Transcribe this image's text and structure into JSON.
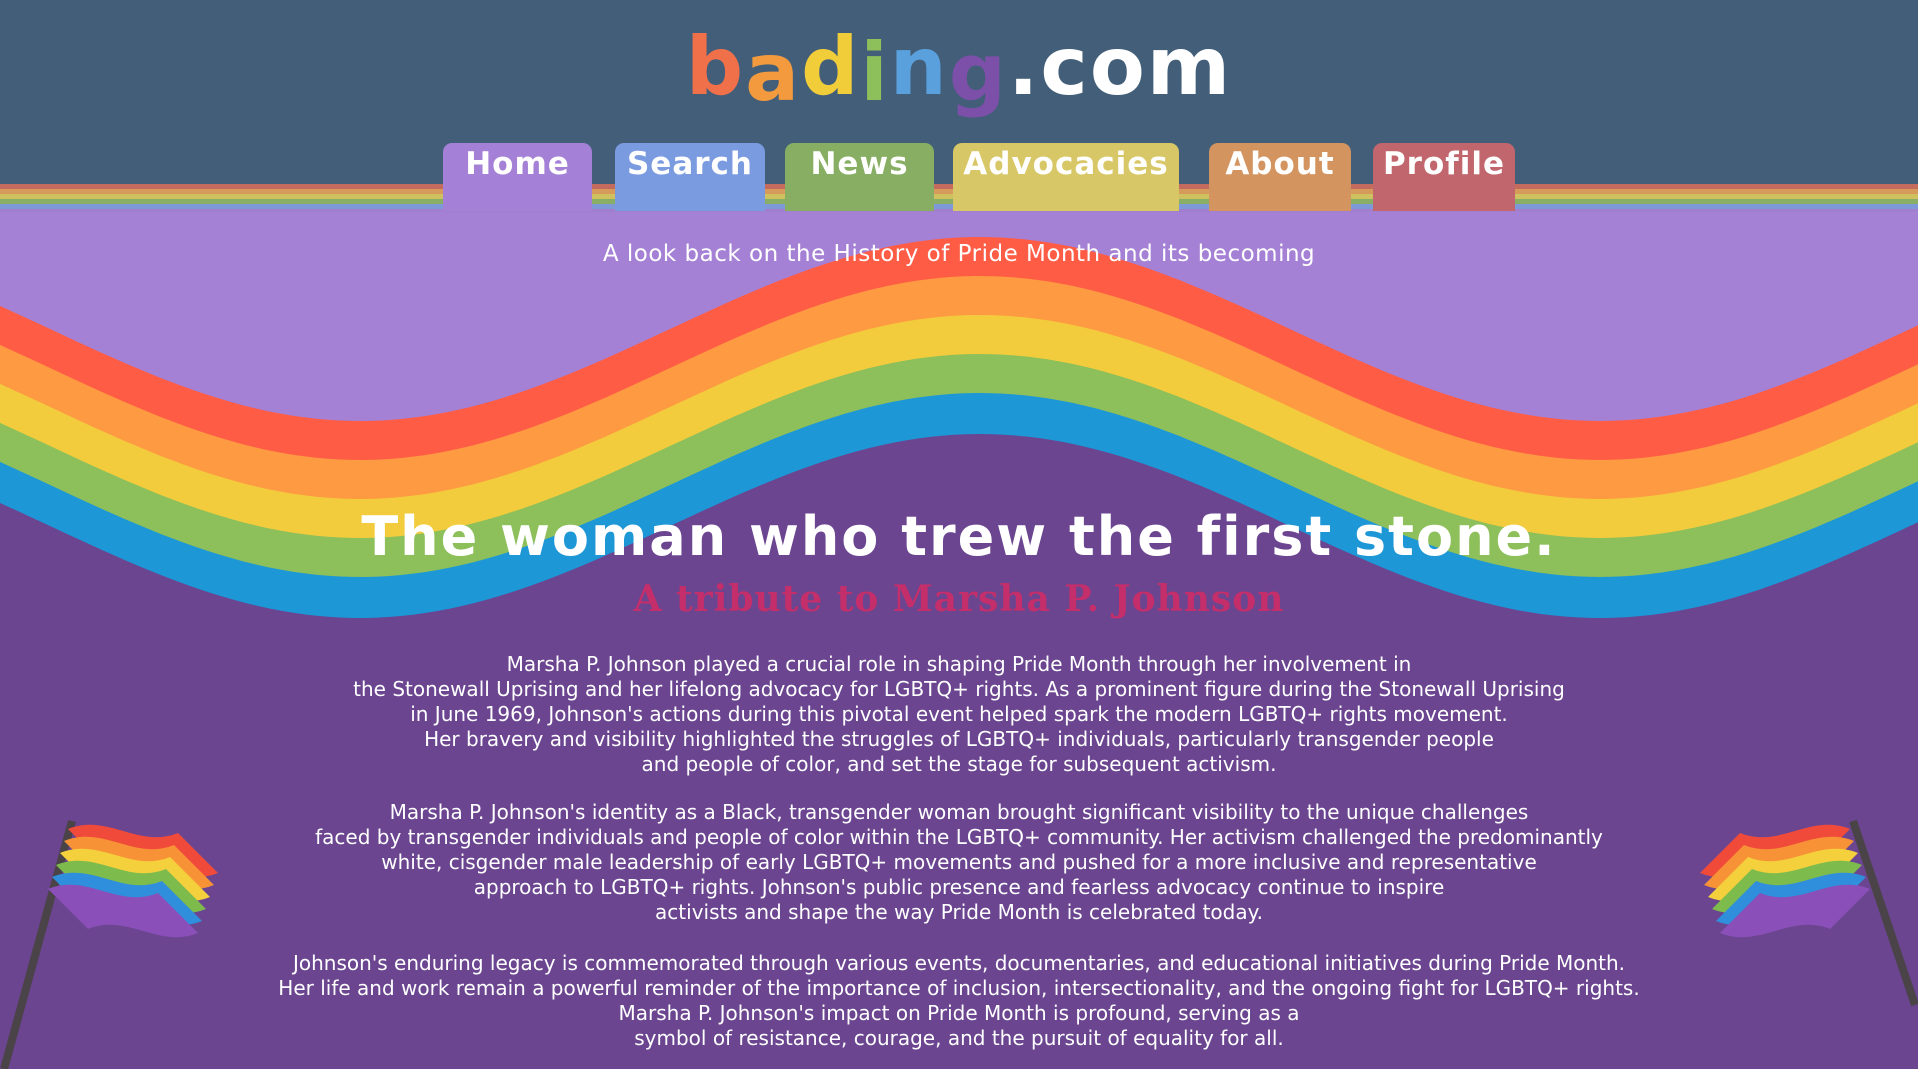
{
  "site": {
    "logo": {
      "letters": [
        {
          "char": "b",
          "color": "#f0704a"
        },
        {
          "char": "a",
          "color": "#f39a3e"
        },
        {
          "char": "d",
          "color": "#f2cd3a"
        },
        {
          "char": "i",
          "color": "#8dbf5b"
        },
        {
          "char": "n",
          "color": "#5aa0dc"
        },
        {
          "char": "g",
          "color": "#7c4fa8"
        },
        {
          "char": ".com",
          "color": "#ffffff"
        }
      ]
    }
  },
  "nav": {
    "tabs": [
      {
        "label": "Home",
        "color": "#a481d6",
        "active": true
      },
      {
        "label": "Search",
        "color": "#7b9be0",
        "active": false
      },
      {
        "label": "News",
        "color": "#87ae62",
        "active": false
      },
      {
        "label": "Advocacies",
        "color": "#d8c766",
        "active": false
      },
      {
        "label": "About",
        "color": "#d3945f",
        "active": false
      },
      {
        "label": "Profile",
        "color": "#c0666c",
        "active": false
      }
    ]
  },
  "hero": {
    "tagline": "A look back on the History of Pride Month and its becoming",
    "title": "The woman who trew the first stone.",
    "subtitle": "A tribute to Marsha P. Johnson"
  },
  "article": {
    "paragraphs": [
      [
        "Marsha P. Johnson played a crucial role in shaping Pride Month through her involvement in",
        "the Stonewall Uprising and her lifelong advocacy for LGBTQ+ rights. As a prominent figure during the Stonewall Uprising",
        "in June 1969, Johnson's actions during this pivotal event helped spark the modern LGBTQ+ rights movement.",
        "Her bravery and visibility highlighted the struggles of LGBTQ+ individuals, particularly transgender people",
        "and people of color, and set the stage for subsequent activism."
      ],
      [
        "Marsha P. Johnson's identity as a Black, transgender woman brought significant visibility to the unique challenges",
        "faced by transgender individuals and people of color within the LGBTQ+ community. Her activism challenged the predominantly",
        "white, cisgender male leadership of early LGBTQ+ movements and pushed for a more inclusive and representative",
        "approach to LGBTQ+ rights. Johnson's public presence and fearless advocacy continue to inspire",
        "activists and shape the way Pride Month is celebrated today."
      ],
      [
        "Johnson's enduring legacy is commemorated through various events, documentaries, and educational initiatives during Pride Month.",
        "Her life and work remain a powerful reminder of the importance of inclusion, intersectionality, and the ongoing fight for LGBTQ+ rights.",
        "Marsha P. Johnson's impact on Pride Month is profound, serving as a",
        "symbol of resistance, courage, and the pursuit of equality for all."
      ]
    ]
  },
  "colors": {
    "header_bg": "#425e79",
    "hero_bg": "#a581d5",
    "body_bg": "#6b4590",
    "rainbow": [
      "#fe5c45",
      "#fd9a42",
      "#f3cc3d",
      "#8dbf5b",
      "#1d97d6"
    ],
    "subtitle": "#c42e6a"
  }
}
